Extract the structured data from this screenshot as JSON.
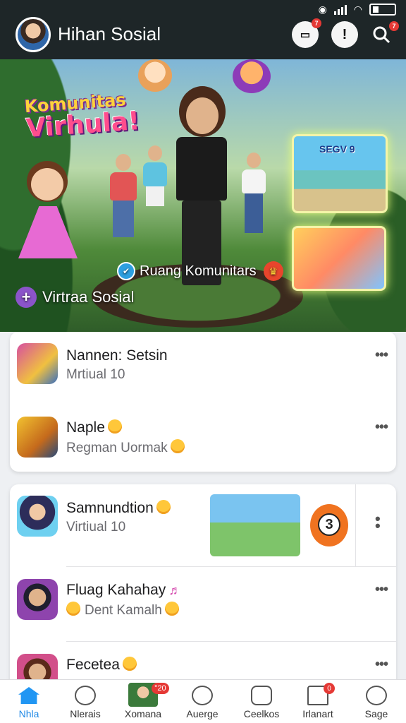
{
  "header": {
    "title": "Hihan Sosial",
    "notification_count": "7",
    "search_count": "7"
  },
  "hero": {
    "logo_line1": "Komunitas",
    "logo_line2": "Virhula!",
    "thumb1_title": "SEGV 9",
    "tag": "Ruang Komunitars",
    "sub": "Virtraa Sosial"
  },
  "card1": {
    "rows": [
      {
        "name": "Nannen: Setsin",
        "sub": "Mrtiual 10"
      },
      {
        "name": "Naple",
        "sub": "Regman Uormak"
      }
    ]
  },
  "card2": {
    "rows": [
      {
        "name": "Samnundtion",
        "sub": "Virtiual 10",
        "count": "3"
      },
      {
        "name": "Fluag Kahahay",
        "sub": "Dent Kamalh"
      },
      {
        "name": "Fecetea",
        "sub": ""
      }
    ]
  },
  "nav": {
    "items": [
      {
        "label": "Nhla",
        "icon": "home-icon"
      },
      {
        "label": "Nlerais",
        "icon": "person-icon"
      },
      {
        "label": "Xomana",
        "icon": "photo-avatar",
        "badge": "°20"
      },
      {
        "label": "Auerge",
        "icon": "face-icon"
      },
      {
        "label": "Ceelkos",
        "icon": "chat-icon"
      },
      {
        "label": "Irlanart",
        "icon": "bell-icon",
        "badge": "0"
      },
      {
        "label": "Sage",
        "icon": "profile-icon"
      }
    ]
  },
  "colors": {
    "header_bg": "#1e2628",
    "accent": "#2196f3",
    "badge": "#e53935"
  }
}
